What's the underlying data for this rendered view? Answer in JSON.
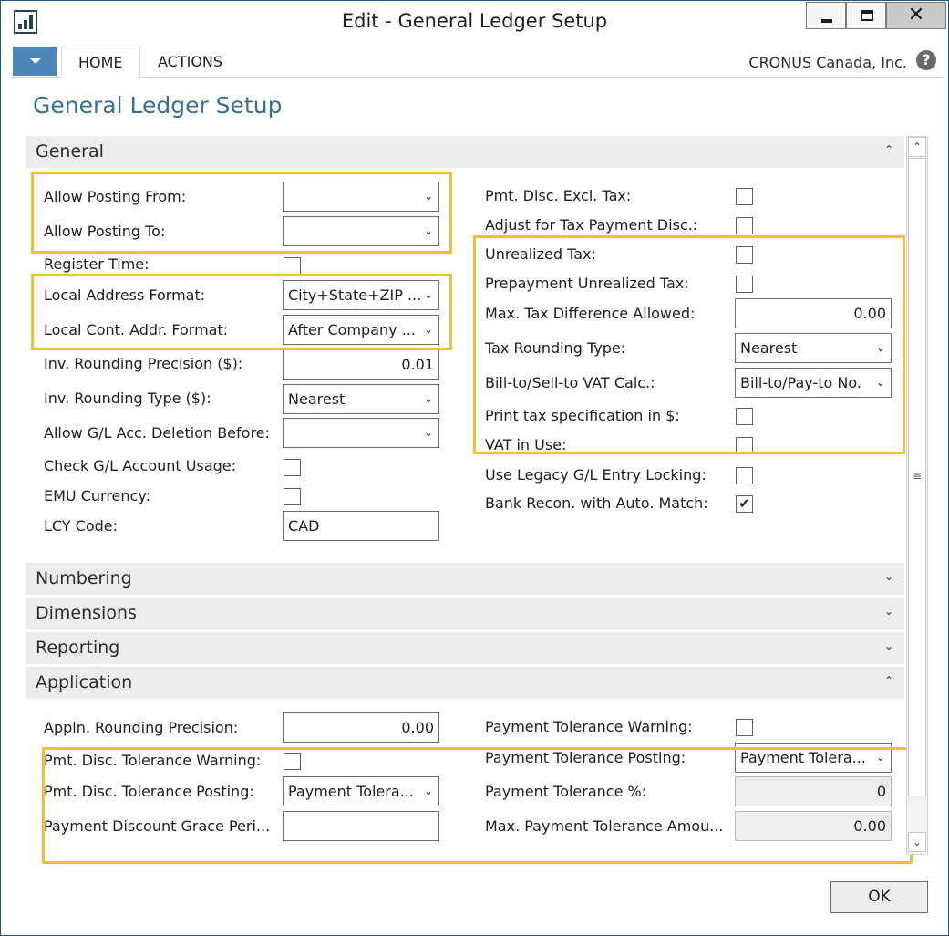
{
  "window": {
    "title": "Edit - General Ledger Setup",
    "min_icon": "minimize-icon",
    "max_icon": "maximize-icon",
    "close_glyph": "✕"
  },
  "ribbon": {
    "tabs": [
      "HOME",
      "ACTIONS"
    ],
    "company": "CRONUS Canada, Inc.",
    "help_glyph": "?"
  },
  "page": {
    "title": "General Ledger Setup"
  },
  "general": {
    "header": "General",
    "left": [
      {
        "label": "Allow Posting From:",
        "type": "select",
        "value": ""
      },
      {
        "label": "Allow Posting To:",
        "type": "select",
        "value": ""
      },
      {
        "label": "Register Time:",
        "type": "checkbox",
        "checked": false
      },
      {
        "label": "Local Address Format:",
        "type": "select",
        "value": "City+State+ZIP ..."
      },
      {
        "label": "Local Cont. Addr. Format:",
        "type": "select",
        "value": "After Company ..."
      },
      {
        "label": "Inv. Rounding Precision ($):",
        "type": "number",
        "value": "0.01"
      },
      {
        "label": "Inv. Rounding Type ($):",
        "type": "select",
        "value": "Nearest"
      },
      {
        "label": "Allow G/L Acc. Deletion Before:",
        "type": "select",
        "value": ""
      },
      {
        "label": "Check G/L Account Usage:",
        "type": "checkbox",
        "checked": false
      },
      {
        "label": "EMU Currency:",
        "type": "checkbox",
        "checked": false
      },
      {
        "label": "LCY Code:",
        "type": "text",
        "value": "CAD"
      }
    ],
    "right": [
      {
        "label": "Pmt. Disc. Excl. Tax:",
        "type": "checkbox",
        "checked": false
      },
      {
        "label": "Adjust for Tax Payment Disc.:",
        "type": "checkbox",
        "checked": false
      },
      {
        "label": "Unrealized Tax:",
        "type": "checkbox",
        "checked": false
      },
      {
        "label": "Prepayment Unrealized Tax:",
        "type": "checkbox",
        "checked": false
      },
      {
        "label": "Max. Tax Difference Allowed:",
        "type": "number",
        "value": "0.00"
      },
      {
        "label": "Tax Rounding Type:",
        "type": "select",
        "value": "Nearest"
      },
      {
        "label": "Bill-to/Sell-to VAT Calc.:",
        "type": "select",
        "value": "Bill-to/Pay-to No."
      },
      {
        "label": "Print tax specification in $:",
        "type": "checkbox",
        "checked": false
      },
      {
        "label": "VAT in Use:",
        "type": "checkbox",
        "checked": false
      },
      {
        "label": "Use Legacy G/L Entry Locking:",
        "type": "checkbox",
        "checked": false
      },
      {
        "label": "Bank Recon. with Auto. Match:",
        "type": "checkbox",
        "checked": true
      }
    ]
  },
  "collapsed_tabs": [
    "Numbering",
    "Dimensions",
    "Reporting"
  ],
  "application": {
    "header": "Application",
    "left": [
      {
        "label": "Appln. Rounding Precision:",
        "type": "number",
        "value": "0.00"
      },
      {
        "label": "Pmt. Disc. Tolerance Warning:",
        "type": "checkbox",
        "checked": false
      },
      {
        "label": "Pmt. Disc. Tolerance Posting:",
        "type": "select",
        "value": "Payment Tolera..."
      },
      {
        "label": "Payment Discount Grace Peri...",
        "type": "text",
        "value": ""
      }
    ],
    "right": [
      {
        "label": "Payment Tolerance Warning:",
        "type": "checkbox",
        "checked": false
      },
      {
        "label": "Payment Tolerance Posting:",
        "type": "select",
        "value": "Payment Tolera..."
      },
      {
        "label": "Payment Tolerance %:",
        "type": "readonly",
        "value": "0"
      },
      {
        "label": "Max. Payment Tolerance Amou...",
        "type": "readonly",
        "value": "0.00"
      }
    ]
  },
  "glyphs": {
    "expand": "⌄",
    "collapse": "⌃",
    "dropdown": "⌄",
    "check": "✔",
    "scroll_up": "⌃",
    "scroll_down": "⌄",
    "grip": "≡"
  },
  "colors": {
    "accent": "#4d87b8",
    "title": "#3a6f8f",
    "highlight": "#f2c12e",
    "tab_bg": "#ececec"
  },
  "footer": {
    "ok_label": "OK"
  }
}
